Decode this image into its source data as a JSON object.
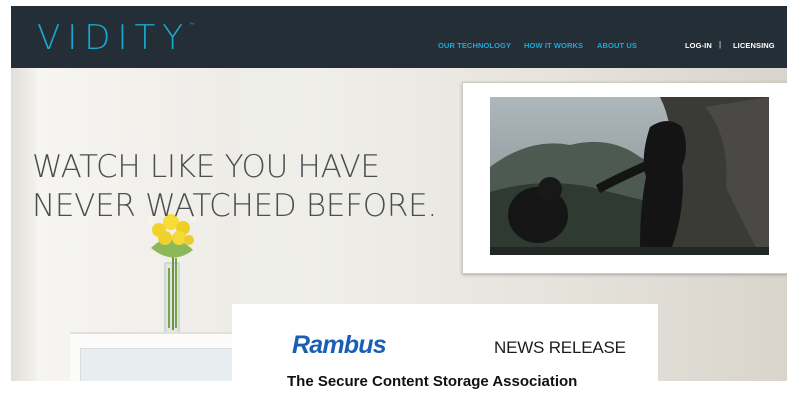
{
  "header": {
    "logo": "VIDITY",
    "logo_tm": "™",
    "nav": {
      "our_technology": "OUR TECHNOLOGY",
      "how_it_works": "HOW IT WORKS",
      "about_us": "ABOUT US",
      "log_in": "LOG-IN",
      "separator": "|",
      "licensing": "LICENSING"
    }
  },
  "hero": {
    "headline_line1": "WATCH LIKE YOU HAVE",
    "headline_line2": "NEVER WATCHED BEFORE."
  },
  "news_card": {
    "company": "Rambus",
    "label": "NEWS RELEASE",
    "headline_partial": "The Secure Content Storage Association"
  },
  "colors": {
    "header_bg": "#232e36",
    "accent": "#1fa8d8",
    "rambus_blue": "#1b5fb3"
  }
}
